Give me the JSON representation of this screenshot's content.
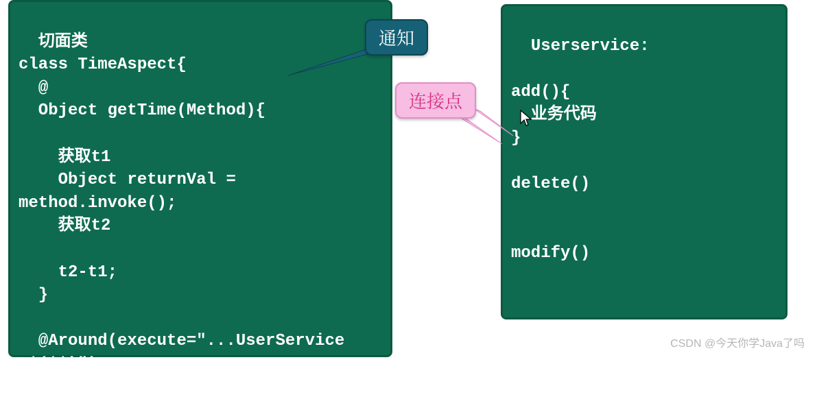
{
  "left_panel": {
    "code": "切面类\nclass TimeAspect{\n  @\n  Object getTime(Method){\n\n    获取t1\n    Object returnVal =\nmethod.invoke();\n    获取t2\n\n    t2-t1;\n  }\n\n  @Around(execute=\"...UserService\n.*(**)\")\n  begin(Method method):"
  },
  "right_panel": {
    "code": "Userservice:\n\nadd(){\n  业务代码\n}\n\ndelete()\n\n\nmodify()\n\n\n...."
  },
  "callouts": {
    "advice": "通知",
    "joinpoint": "连接点"
  },
  "watermark": "CSDN @今天你学Java了吗",
  "colors": {
    "panel_bg": "#0e6b4f",
    "panel_border": "#0c5942",
    "teal_bg": "#176176",
    "teal_border": "#0d4452",
    "pink_bg": "#f7bde2",
    "pink_border": "#e18ec8",
    "pink_text": "#d63384"
  }
}
